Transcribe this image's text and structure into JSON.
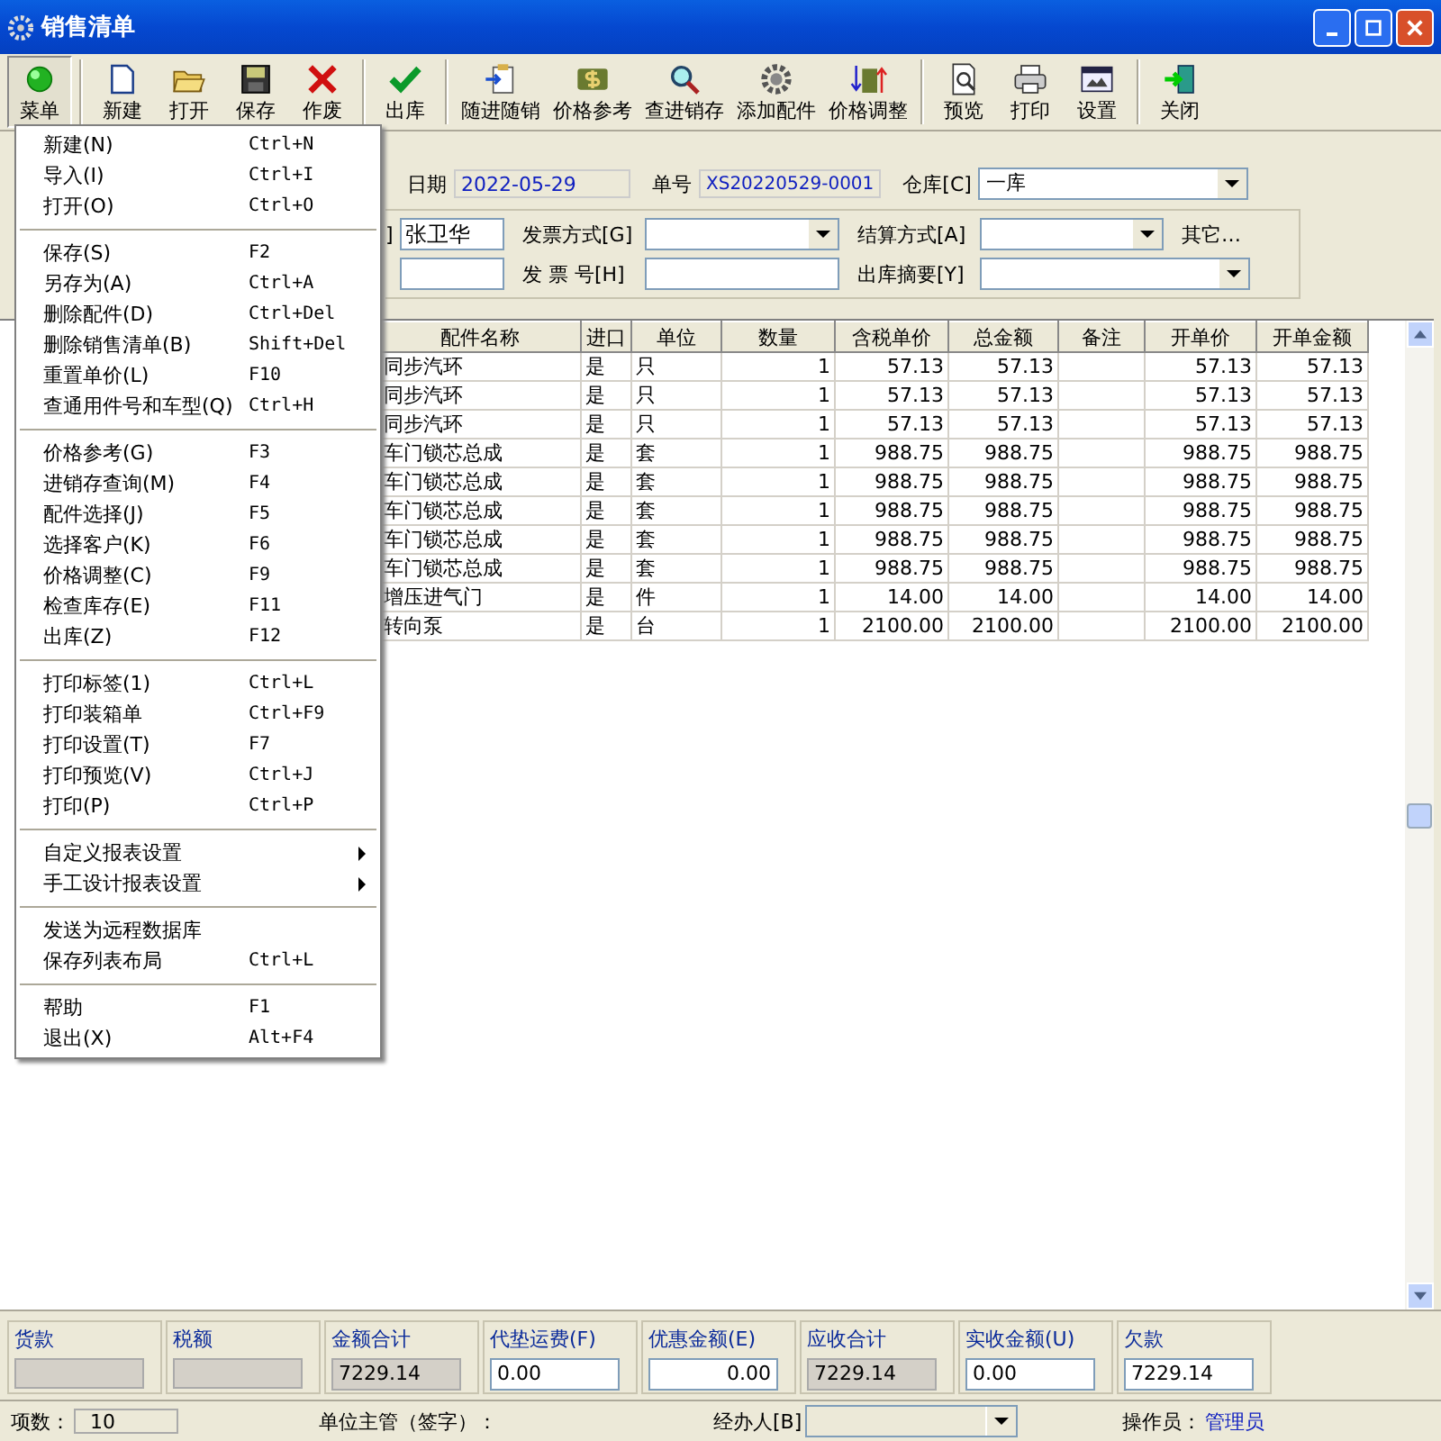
{
  "window": {
    "title": "销售清单"
  },
  "toolbar": [
    [
      {
        "label": "菜单",
        "kind": "ball",
        "selected": true
      }
    ],
    [
      {
        "label": "新建",
        "kind": "document",
        "selected": false
      },
      {
        "label": "打开",
        "kind": "folder",
        "selected": false
      },
      {
        "label": "保存",
        "kind": "disk",
        "selected": false
      },
      {
        "label": "作废",
        "kind": "cross",
        "selected": false
      }
    ],
    [
      {
        "label": "出库",
        "kind": "check",
        "selected": false
      }
    ],
    [
      {
        "label": "随进随销",
        "kind": "clipboard",
        "selected": false
      },
      {
        "label": "价格参考",
        "kind": "dollar",
        "selected": false
      },
      {
        "label": "查进销存",
        "kind": "magnifier",
        "selected": false
      },
      {
        "label": "添加配件",
        "kind": "gear",
        "selected": false
      },
      {
        "label": "价格调整",
        "kind": "dollar-arrows",
        "selected": false
      }
    ],
    [
      {
        "label": "预览",
        "kind": "preview",
        "selected": false
      },
      {
        "label": "打印",
        "kind": "printer",
        "selected": false
      },
      {
        "label": "设置",
        "kind": "screen",
        "selected": false
      }
    ],
    [
      {
        "label": "关闭",
        "kind": "exit",
        "selected": false
      }
    ]
  ],
  "menu": [
    [
      {
        "label": "新建(N)",
        "shortcut": "Ctrl+N",
        "submenu": false
      },
      {
        "label": "导入(I)",
        "shortcut": "Ctrl+I",
        "submenu": false
      },
      {
        "label": "打开(O)",
        "shortcut": "Ctrl+O",
        "submenu": false
      }
    ],
    [
      {
        "label": "保存(S)",
        "shortcut": "F2",
        "submenu": false
      },
      {
        "label": "另存为(A)",
        "shortcut": "Ctrl+A",
        "submenu": false
      },
      {
        "label": "删除配件(D)",
        "shortcut": "Ctrl+Del",
        "submenu": false
      },
      {
        "label": "删除销售清单(B)",
        "shortcut": "Shift+Del",
        "submenu": false
      },
      {
        "label": "重置单价(L)",
        "shortcut": "F10",
        "submenu": false
      },
      {
        "label": "查通用件号和车型(Q)",
        "shortcut": "Ctrl+H",
        "submenu": false
      }
    ],
    [
      {
        "label": "价格参考(G)",
        "shortcut": "F3",
        "submenu": false
      },
      {
        "label": "进销存查询(M)",
        "shortcut": "F4",
        "submenu": false
      },
      {
        "label": "配件选择(J)",
        "shortcut": "F5",
        "submenu": false
      },
      {
        "label": "选择客户(K)",
        "shortcut": "F6",
        "submenu": false
      },
      {
        "label": "价格调整(C)",
        "shortcut": "F9",
        "submenu": false
      },
      {
        "label": "检查库存(E)",
        "shortcut": "F11",
        "submenu": false
      },
      {
        "label": "出库(Z)",
        "shortcut": "F12",
        "submenu": false
      }
    ],
    [
      {
        "label": "打印标签(1)",
        "shortcut": "Ctrl+L",
        "submenu": false
      },
      {
        "label": "打印装箱单",
        "shortcut": "Ctrl+F9",
        "submenu": false
      },
      {
        "label": "打印设置(T)",
        "shortcut": "F7",
        "submenu": false
      },
      {
        "label": "打印预览(V)",
        "shortcut": "Ctrl+J",
        "submenu": false
      },
      {
        "label": "打印(P)",
        "shortcut": "Ctrl+P",
        "submenu": false
      }
    ],
    [
      {
        "label": "自定义报表设置",
        "submenu": true
      },
      {
        "label": "手工设计报表设置",
        "submenu": true
      }
    ],
    [
      {
        "label": "发送为远程数据库",
        "submenu": false
      },
      {
        "label": "保存列表布局",
        "shortcut": "Ctrl+L",
        "submenu": false
      }
    ],
    [
      {
        "label": "帮助",
        "shortcut": "F1",
        "submenu": false
      },
      {
        "label": "退出(X)",
        "shortcut": "Alt+F4",
        "submenu": false
      }
    ]
  ],
  "header": {
    "date_label": "日期",
    "date": "2022-05-29",
    "number_label": "单号",
    "number": "XS20220529-0001",
    "warehouse_label": "仓库[C]",
    "warehouse": "一库",
    "label_fragment": "]",
    "customer": "张卫华",
    "invoice_type_label": "发票方式[G]",
    "invoice_no_label": "发 票 号[H]",
    "settlement_label": "结算方式[A]",
    "other": "其它…",
    "summary_label": "出库摘要[Y]"
  },
  "table": {
    "columns": [
      "配件名称",
      "进口",
      "单位",
      "数量",
      "含税单价",
      "总金额",
      "备注",
      "开单价",
      "开单金额"
    ],
    "rows": [
      [
        "同步汽环",
        "是",
        "只",
        "1",
        "57.13",
        "57.13",
        "",
        "57.13",
        "57.13"
      ],
      [
        "同步汽环",
        "是",
        "只",
        "1",
        "57.13",
        "57.13",
        "",
        "57.13",
        "57.13"
      ],
      [
        "同步汽环",
        "是",
        "只",
        "1",
        "57.13",
        "57.13",
        "",
        "57.13",
        "57.13"
      ],
      [
        "车门锁芯总成",
        "是",
        "套",
        "1",
        "988.75",
        "988.75",
        "",
        "988.75",
        "988.75"
      ],
      [
        "车门锁芯总成",
        "是",
        "套",
        "1",
        "988.75",
        "988.75",
        "",
        "988.75",
        "988.75"
      ],
      [
        "车门锁芯总成",
        "是",
        "套",
        "1",
        "988.75",
        "988.75",
        "",
        "988.75",
        "988.75"
      ],
      [
        "车门锁芯总成",
        "是",
        "套",
        "1",
        "988.75",
        "988.75",
        "",
        "988.75",
        "988.75"
      ],
      [
        "车门锁芯总成",
        "是",
        "套",
        "1",
        "988.75",
        "988.75",
        "",
        "988.75",
        "988.75"
      ],
      [
        "增压进气门",
        "是",
        "件",
        "1",
        "14.00",
        "14.00",
        "",
        "14.00",
        "14.00"
      ],
      [
        "转向泵",
        "是",
        "台",
        "1",
        "2100.00",
        "2100.00",
        "",
        "2100.00",
        "2100.00"
      ]
    ]
  },
  "totals": [
    {
      "label": "货款",
      "readonly": true
    },
    {
      "label": "税额",
      "readonly": true
    },
    {
      "label": "金额合计",
      "value": "7229.14",
      "readonly": true
    },
    {
      "label": "代垫运费(F)",
      "value": "0.00",
      "readonly": false
    },
    {
      "label": "优惠金额(E)",
      "value": "0.00",
      "readonly": false
    },
    {
      "label": "应收合计",
      "value": "7229.14",
      "readonly": true
    },
    {
      "label": "实收金额(U)",
      "value": "0.00",
      "readonly": false
    },
    {
      "label": "欠款",
      "value": "7229.14",
      "readonly": false
    }
  ],
  "status_bar": {
    "count_label": "项数：",
    "count": "10",
    "supervisor_label": "单位主管（签字）：",
    "handler_label": "经办人[B]",
    "operator_label": "操作员：",
    "operator": "管理员"
  }
}
